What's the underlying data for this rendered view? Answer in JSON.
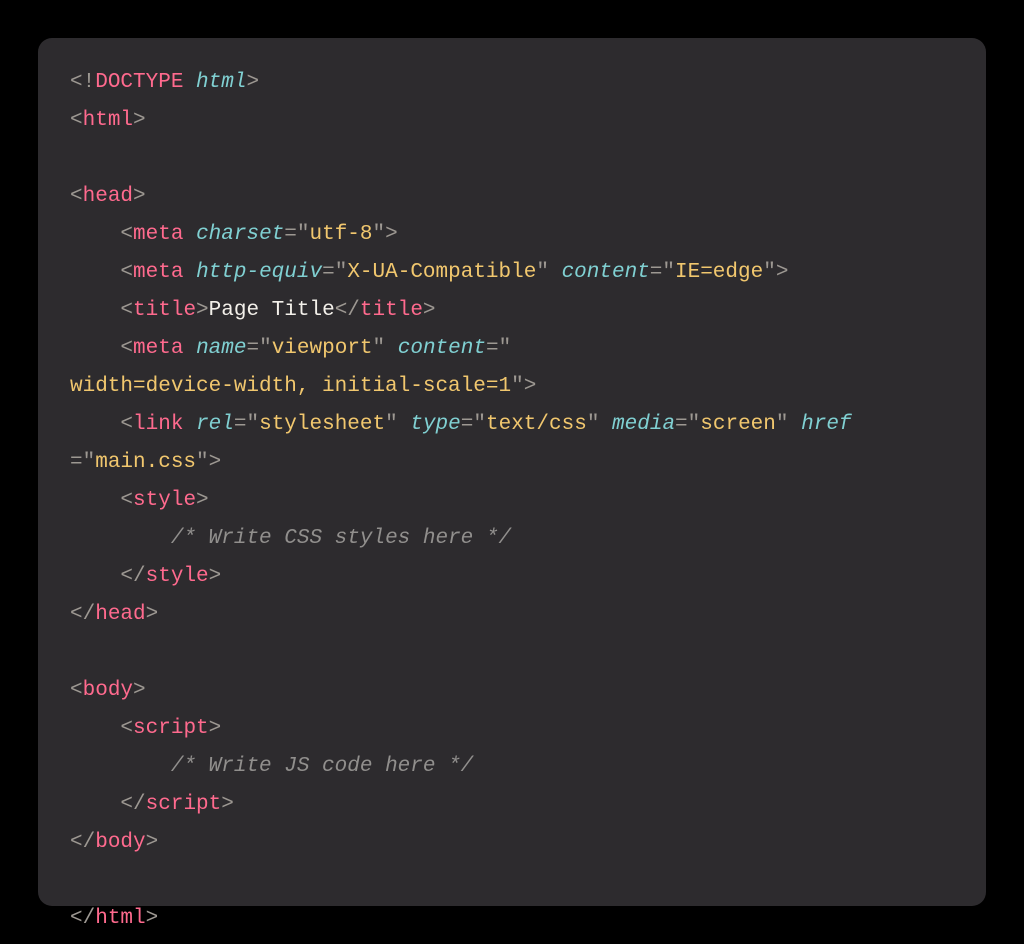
{
  "code": {
    "line1": {
      "lt": "<",
      "bang": "!",
      "doctype": "DOCTYPE",
      "sp": " ",
      "html": "html",
      "gt": ">"
    },
    "line2": {
      "lt": "<",
      "tag": "html",
      "gt": ">"
    },
    "line3": "",
    "line4": {
      "lt": "<",
      "tag": "head",
      "gt": ">"
    },
    "line5": {
      "indent": "    ",
      "lt": "<",
      "tag": "meta",
      "sp": " ",
      "attr1": "charset",
      "eq1": "=",
      "q1o": "\"",
      "val1": "utf-8",
      "q1c": "\"",
      "gt": ">"
    },
    "line6": {
      "indent": "    ",
      "lt": "<",
      "tag": "meta",
      "sp": " ",
      "attr1": "http-equiv",
      "eq1": "=",
      "q1o": "\"",
      "val1": "X-UA-Compatible",
      "q1c": "\"",
      "sp2": " ",
      "attr2": "content",
      "eq2": "=",
      "q2o": "\"",
      "val2": "IE=edge",
      "q2c": "\"",
      "gt": ">"
    },
    "line7": {
      "indent": "    ",
      "lt": "<",
      "tag": "title",
      "gt": ">",
      "text": "Page Title",
      "lt2": "</",
      "tag2": "title",
      "gt2": ">"
    },
    "line8a": {
      "indent": "    ",
      "lt": "<",
      "tag": "meta",
      "sp": " ",
      "attr1": "name",
      "eq1": "=",
      "q1o": "\"",
      "val1": "viewport",
      "q1c": "\"",
      "sp2": " ",
      "attr2": "content",
      "eq2": "=",
      "q2o": "\""
    },
    "line8b": {
      "val": "width=device-width, initial-scale=1",
      "qc": "\"",
      "gt": ">"
    },
    "line9a": {
      "indent": "    ",
      "lt": "<",
      "tag": "link",
      "sp": " ",
      "attr1": "rel",
      "eq1": "=",
      "q1o": "\"",
      "val1": "stylesheet",
      "q1c": "\"",
      "sp2": " ",
      "attr2": "type",
      "eq2": "=",
      "q2o": "\"",
      "val2": "text/css",
      "q2c": "\"",
      "sp3": " ",
      "attr3": "media",
      "eq3": "=",
      "q3o": "\"",
      "val3": "screen",
      "q3c": "\"",
      "sp4": " ",
      "attr4": "href"
    },
    "line9b": {
      "eq": "=",
      "qo": "\"",
      "val": "main.css",
      "qc": "\"",
      "gt": ">"
    },
    "line10": {
      "indent": "    ",
      "lt": "<",
      "tag": "style",
      "gt": ">"
    },
    "line11": {
      "indent": "        ",
      "comment": "/* Write CSS styles here */"
    },
    "line12": {
      "indent": "    ",
      "lt": "</",
      "tag": "style",
      "gt": ">"
    },
    "line13": {
      "lt": "</",
      "tag": "head",
      "gt": ">"
    },
    "line14": "",
    "line15": {
      "lt": "<",
      "tag": "body",
      "gt": ">"
    },
    "line16": {
      "indent": "    ",
      "lt": "<",
      "tag": "script",
      "gt": ">"
    },
    "line17": {
      "indent": "        ",
      "comment": "/* Write JS code here */"
    },
    "line18": {
      "indent": "    ",
      "lt": "</",
      "tag": "script",
      "gt": ">"
    },
    "line19": {
      "lt": "</",
      "tag": "body",
      "gt": ">"
    },
    "line20": "",
    "line21": {
      "lt": "</",
      "tag": "html",
      "gt": ">"
    }
  }
}
